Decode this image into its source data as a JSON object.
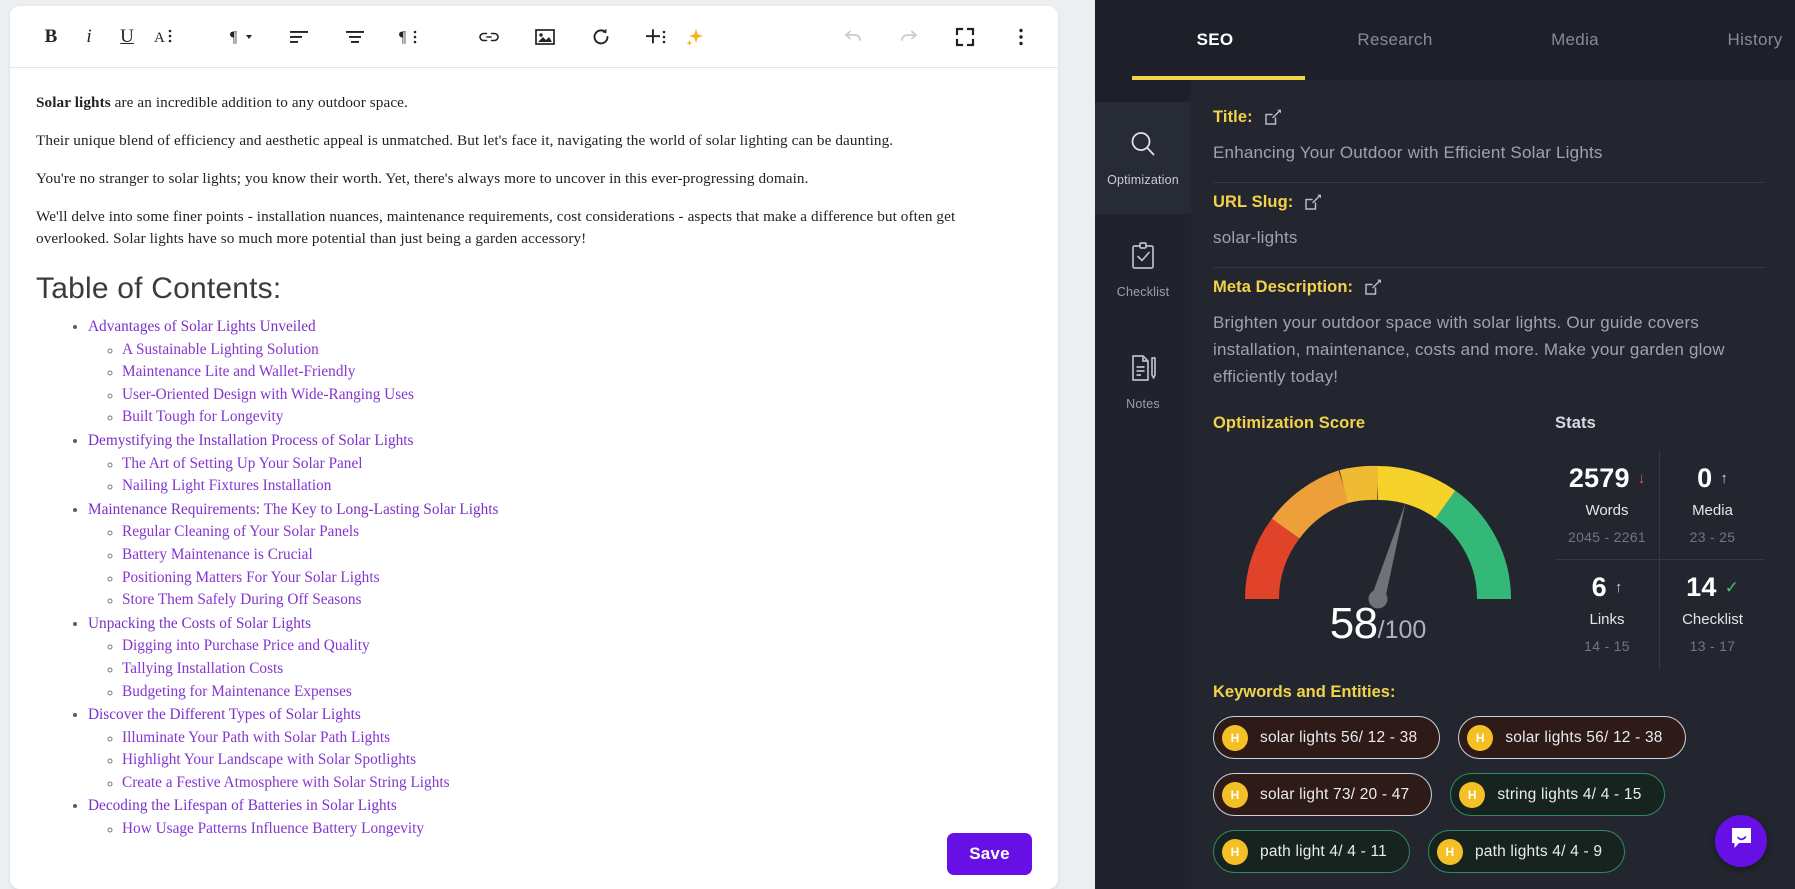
{
  "editor": {
    "toolbar": {
      "bold": "B",
      "italic": "i",
      "underline": "U",
      "text_color": "A",
      "paragraph_style": "¶",
      "align": "align",
      "align_center": "align-center",
      "paragraph_options": "¶",
      "link": "link",
      "image": "image",
      "regenerate": "regenerate",
      "insert": "insert",
      "ai": "ai-sparkle",
      "undo": "undo",
      "redo": "redo",
      "fullscreen": "fullscreen",
      "more": "more"
    },
    "paragraphs": [
      {
        "bold_lead": "Solar lights",
        "rest": " are an incredible addition to any outdoor space."
      },
      {
        "bold_lead": "",
        "rest": "Their unique blend of efficiency and aesthetic appeal is unmatched. But let's face it, navigating the world of solar lighting can be daunting."
      },
      {
        "bold_lead": "",
        "rest": "You're no stranger to solar lights; you know their worth. Yet, there's always more to uncover in this ever-progressing domain."
      },
      {
        "bold_lead": "",
        "rest": "We'll delve into some finer points - installation nuances, maintenance requirements, cost considerations - aspects that make a difference but often get overlooked. Solar lights have so much more potential than just being a garden accessory!"
      }
    ],
    "toc_heading": "Table of Contents:",
    "toc": [
      {
        "label": "Advantages of Solar Lights Unveiled",
        "children": [
          "A Sustainable Lighting Solution",
          "Maintenance Lite and Wallet-Friendly",
          "User-Oriented Design with Wide-Ranging Uses",
          "Built Tough for Longevity"
        ]
      },
      {
        "label": "Demystifying the Installation Process of Solar Lights",
        "children": [
          "The Art of Setting Up Your Solar Panel",
          "Nailing Light Fixtures Installation"
        ]
      },
      {
        "label": "Maintenance Requirements: The Key to Long-Lasting Solar Lights",
        "children": [
          "Regular Cleaning of Your Solar Panels",
          "Battery Maintenance is Crucial",
          "Positioning Matters For Your Solar Lights",
          "Store Them Safely During Off Seasons"
        ]
      },
      {
        "label": "Unpacking the Costs of Solar Lights",
        "children": [
          "Digging into Purchase Price and Quality",
          "Tallying Installation Costs",
          "Budgeting for Maintenance Expenses"
        ]
      },
      {
        "label": "Discover the Different Types of Solar Lights",
        "children": [
          "Illuminate Your Path with Solar Path Lights",
          "Highlight Your Landscape with Solar Spotlights",
          "Create a Festive Atmosphere with Solar String Lights"
        ]
      },
      {
        "label": "Decoding the Lifespan of Batteries in Solar Lights",
        "children": [
          "How Usage Patterns Influence Battery Longevity"
        ]
      }
    ],
    "save_label": "Save"
  },
  "seo": {
    "tabs": [
      {
        "label": "SEO",
        "active": true
      },
      {
        "label": "Research",
        "active": false
      },
      {
        "label": "Media",
        "active": false
      },
      {
        "label": "History",
        "active": false
      }
    ],
    "rail": [
      {
        "label": "Optimization",
        "icon": "magnifier-icon",
        "active": true
      },
      {
        "label": "Checklist",
        "icon": "clipboard-check-icon",
        "active": false
      },
      {
        "label": "Notes",
        "icon": "note-pen-icon",
        "active": false
      }
    ],
    "title": {
      "label": "Title:",
      "value": "Enhancing Your Outdoor with Efficient Solar Lights"
    },
    "slug": {
      "label": "URL Slug:",
      "value": "solar-lights"
    },
    "meta": {
      "label": "Meta Description:",
      "value": "Brighten your outdoor space with solar lights. Our guide covers installation, maintenance, costs and more. Make your garden glow efficiently today!"
    },
    "score": {
      "title": "Optimization Score",
      "value": "58",
      "denominator": "/100"
    },
    "stats": {
      "title": "Stats",
      "items": [
        {
          "value": "2579",
          "trend": "down",
          "trend_glyph": "↓",
          "label": "Words",
          "range": "2045 - 2261"
        },
        {
          "value": "0",
          "trend": "up",
          "trend_glyph": "↑",
          "label": "Media",
          "range": "23 - 25"
        },
        {
          "value": "6",
          "trend": "up",
          "trend_glyph": "↑",
          "label": "Links",
          "range": "14 - 15"
        },
        {
          "value": "14",
          "trend": "ok",
          "trend_glyph": "✓",
          "label": "Checklist",
          "range": "13 - 17"
        }
      ]
    },
    "keywords": {
      "title": "Keywords and Entities:",
      "items": [
        {
          "badge": "H",
          "text": "solar lights 56/ 12 - 38",
          "state": "over"
        },
        {
          "badge": "H",
          "text": "solar lights 56/ 12 - 38",
          "state": "over"
        },
        {
          "badge": "H",
          "text": "solar light 73/ 20 - 47",
          "state": "over"
        },
        {
          "badge": "H",
          "text": "string lights 4/ 4 - 15",
          "state": "ok"
        },
        {
          "badge": "H",
          "text": "path light 4/ 4 - 11",
          "state": "ok"
        },
        {
          "badge": "H",
          "text": "path lights 4/ 4 - 9",
          "state": "ok"
        }
      ]
    },
    "chat": {
      "icon": "chat-bubble-icon"
    }
  },
  "chart_data": {
    "type": "gauge",
    "title": "Optimization Score",
    "value": 58,
    "min": 0,
    "max": 100,
    "unit": "/100",
    "segments": [
      {
        "from": 0,
        "to": 20,
        "color": "#e0422a"
      },
      {
        "from": 20,
        "to": 40,
        "color": "#eda03a"
      },
      {
        "from": 40,
        "to": 60,
        "color": "#f5cf2a"
      },
      {
        "from": 60,
        "to": 80,
        "color": "#f2d32b"
      },
      {
        "from": 80,
        "to": 100,
        "color": "#34b878"
      }
    ],
    "needle_color": "#6f7278",
    "xlabel": "",
    "ylabel": ""
  },
  "colors": {
    "accent_yellow": "#f2d34a",
    "purple": "#6610e6",
    "panel_bg": "#23262f",
    "tabs_bg": "#1d2029",
    "link_purple": "#7b31c9",
    "green": "#3fc26a",
    "red": "#e2555f"
  }
}
